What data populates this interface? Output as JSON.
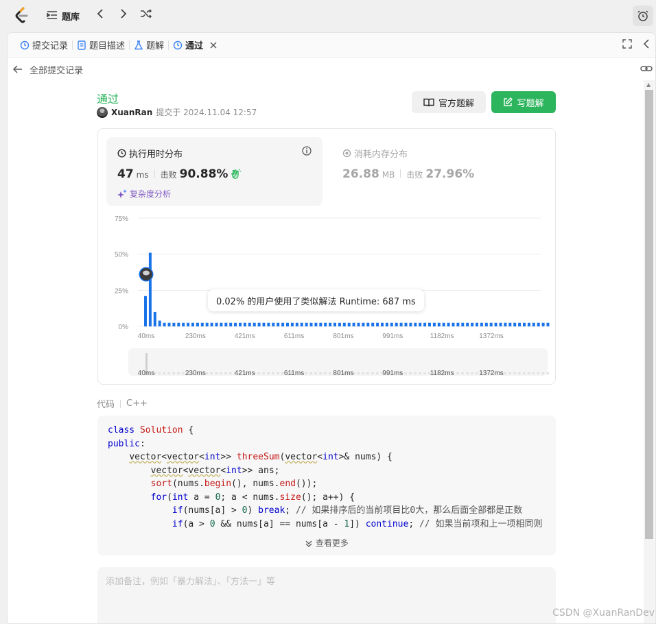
{
  "topnav": {
    "title": "题库"
  },
  "tabs": [
    {
      "label": "提交记录"
    },
    {
      "label": "题目描述"
    },
    {
      "label": "题解"
    },
    {
      "label": "通过"
    }
  ],
  "subbar": {
    "back_label": "全部提交记录"
  },
  "submission": {
    "status": "通过",
    "user": "XuanRan",
    "submitted_text": "提交于 2024.11.04 12:57",
    "official_btn": "官方题解",
    "write_btn": "写题解"
  },
  "runtime": {
    "title": "执行用时分布",
    "value": "47",
    "unit": "ms",
    "beat_label": "击败",
    "beat_value": "90.88%",
    "complexity_label": "复杂度分析"
  },
  "memory": {
    "title": "消耗内存分布",
    "value": "26.88",
    "unit": "MB",
    "beat_label": "击败",
    "beat_value": "27.96%"
  },
  "tooltip": "0.02% 的用户使用了类似解法 Runtime: 687 ms",
  "chart_data": {
    "type": "bar",
    "y_ticks": [
      "75%",
      "50%",
      "25%",
      "0%"
    ],
    "ylim": [
      0,
      75
    ],
    "x_ticks": [
      "40ms",
      "230ms",
      "421ms",
      "611ms",
      "801ms",
      "991ms",
      "1182ms",
      "1372ms"
    ],
    "minimap_ticks": [
      "40ms",
      "230ms",
      "421ms",
      "611ms",
      "801ms",
      "991ms",
      "1182ms",
      "1372ms"
    ],
    "head_values": [
      21,
      51,
      10,
      4
    ],
    "tail_value": 2.5,
    "tail_count": 84,
    "bar_color": "#1a73e8",
    "user_bar_index": 0
  },
  "code_section": {
    "label": "代码",
    "lang": "C++",
    "more_label": "查看更多",
    "lines": [
      "class Solution {",
      "public:",
      "    vector<vector<int>> threeSum(vector<int>& nums) {",
      "        vector<vector<int>> ans;",
      "        sort(nums.begin(), nums.end());",
      "        for(int a = 0; a < nums.size(); a++) {",
      "            if(nums[a] > 0) break; // 如果排序后的当前项目比0大，那么后面全部都是正数",
      "            if(a > 0 && nums[a] == nums[a - 1]) continue; // 如果当前项和上一项相同则"
    ]
  },
  "note": {
    "placeholder": "添加备注，例如「暴力解法」、「方法一」等"
  },
  "watermark": "CSDN @XuanRanDev",
  "colors": {
    "accent_green": "#2db55d",
    "bar_blue": "#1a73e8",
    "purple": "#7e57c2"
  }
}
